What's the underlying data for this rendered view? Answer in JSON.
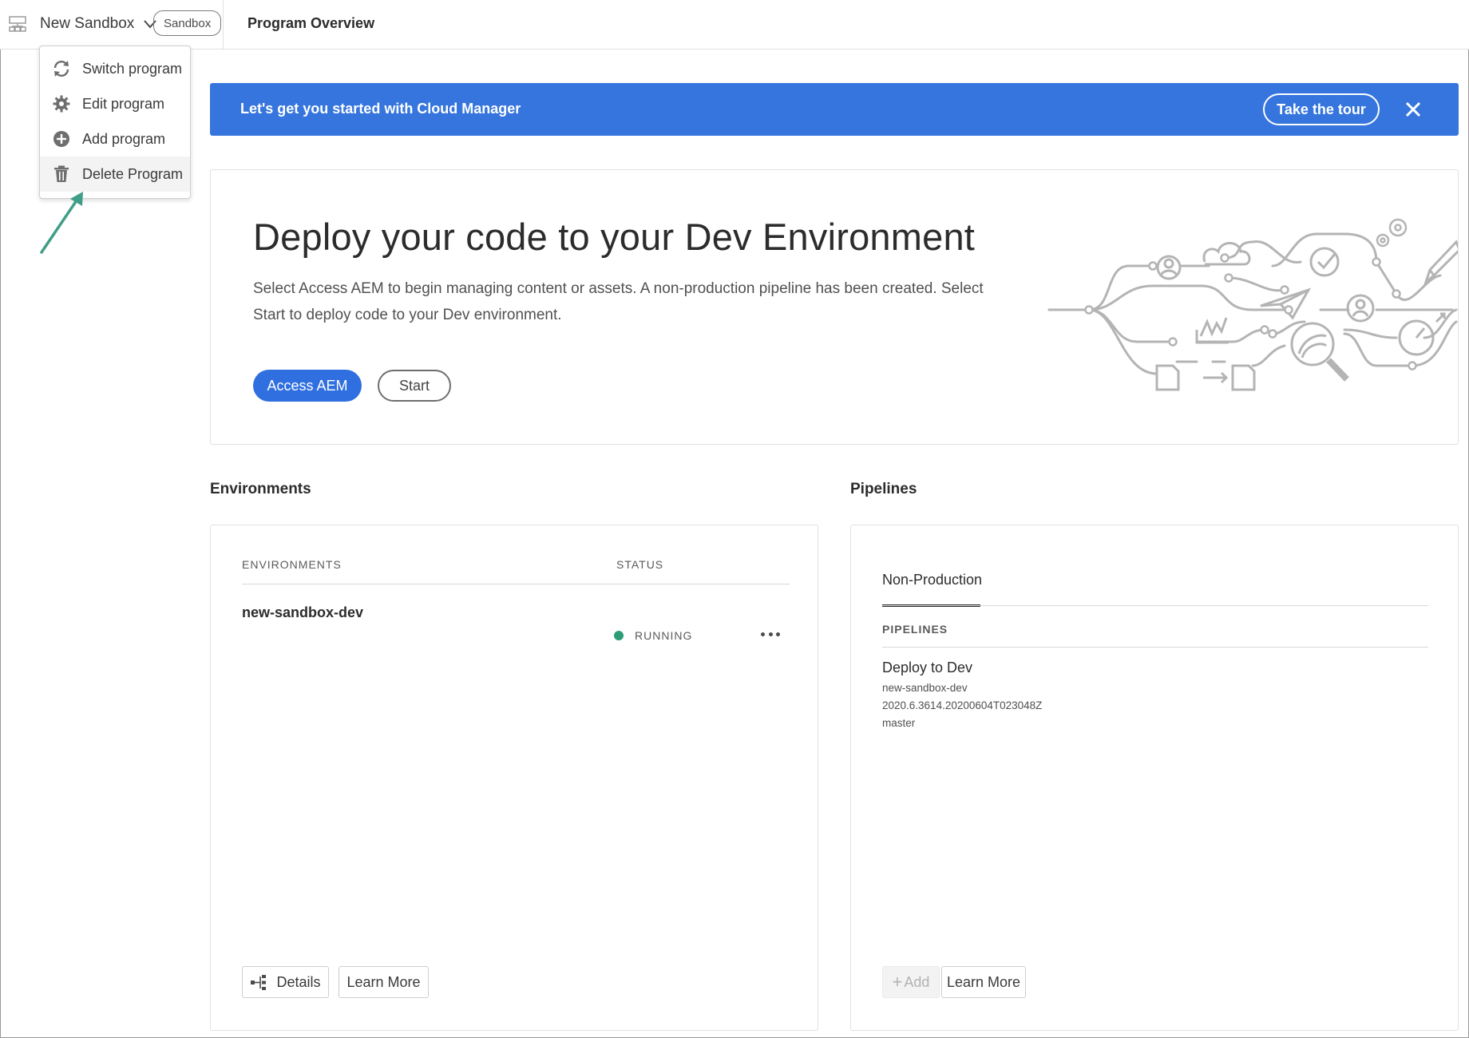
{
  "header": {
    "program_name": "New Sandbox",
    "badge": "Sandbox",
    "page_title": "Program Overview"
  },
  "program_menu": {
    "items": [
      {
        "label": "Switch program",
        "icon": "refresh-icon"
      },
      {
        "label": "Edit program",
        "icon": "gear-icon"
      },
      {
        "label": "Add program",
        "icon": "add-circle-icon"
      },
      {
        "label": "Delete Program",
        "icon": "trash-icon"
      }
    ],
    "highlighted_index": 3
  },
  "banner": {
    "text": "Let's get you started with Cloud Manager",
    "tour_label": "Take the tour",
    "color": "#3575dd"
  },
  "hero": {
    "title": "Deploy your code to your Dev Environment",
    "description": "Select Access AEM to begin managing content or assets. A non-production pipeline has been created. Select Start to deploy code to your Dev environment.",
    "primary_label": "Access AEM",
    "secondary_label": "Start"
  },
  "environments": {
    "heading": "Environments",
    "col_environments": "ENVIRONMENTS",
    "col_status": "STATUS",
    "rows": [
      {
        "name": "new-sandbox-dev",
        "status": "RUNNING",
        "status_color": "#2d9d78"
      }
    ],
    "details_label": "Details",
    "learn_more_label": "Learn More"
  },
  "pipelines": {
    "heading": "Pipelines",
    "tab_label": "Non-Production",
    "col_pipelines": "PIPELINES",
    "items": [
      {
        "name": "Deploy to Dev",
        "environment": "new-sandbox-dev",
        "version": "2020.6.3614.20200604T023048Z",
        "branch": "master"
      }
    ],
    "add_label": "Add",
    "learn_more_label": "Learn More"
  },
  "colors": {
    "accent": "#2f6fe0",
    "callout_arrow": "#3f9e87"
  }
}
